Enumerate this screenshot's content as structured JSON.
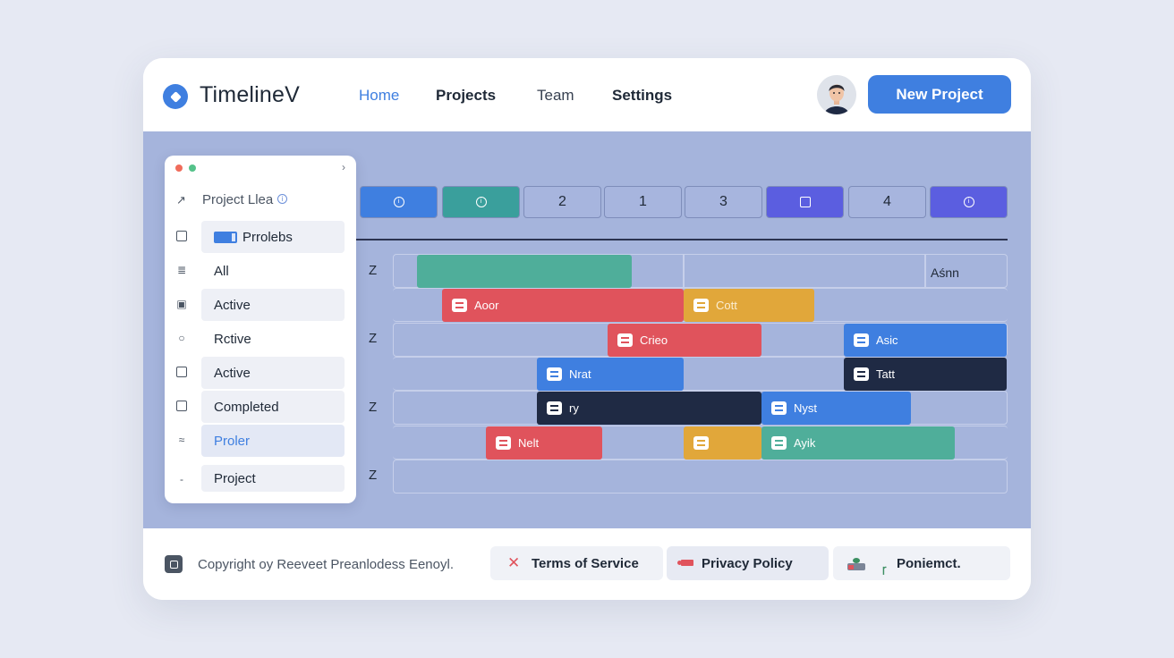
{
  "header": {
    "app_title": "TimelineV",
    "nav": [
      "Home",
      "Projects",
      "Team",
      "Settings"
    ],
    "new_project_label": "New Project"
  },
  "side_panel": {
    "title": "Project Llea",
    "info_glyph": "i",
    "chevron": "›",
    "items": [
      {
        "icon": "square-icon",
        "label": "Prrolebs"
      },
      {
        "icon": "list-icon",
        "label": "All"
      },
      {
        "icon": "play-icon",
        "label": "Active"
      },
      {
        "icon": "chat-icon",
        "label": "Rctive"
      },
      {
        "icon": "square-icon",
        "label": "Active"
      },
      {
        "icon": "square-icon",
        "label": "Completed"
      },
      {
        "icon": "chevrons-icon",
        "label": "Proler"
      },
      {
        "icon": "dash-icon",
        "label": "Project"
      }
    ]
  },
  "timeline": {
    "phases": [
      {
        "type": "icon",
        "color": "#3f7fe0",
        "icon": "circle-icon"
      },
      {
        "type": "icon",
        "color": "#3a9f9c",
        "icon": "circle-icon"
      },
      {
        "type": "text",
        "label": "2"
      },
      {
        "type": "text",
        "label": "1"
      },
      {
        "type": "text",
        "label": "3"
      },
      {
        "type": "icon",
        "color": "#5b5ee0",
        "icon": "square-icon"
      },
      {
        "type": "text",
        "label": "4"
      },
      {
        "type": "icon",
        "color": "#5b5ee0",
        "icon": "circle-icon"
      }
    ],
    "lane_glyph": "Z",
    "assignee_label": "Aśnn",
    "tasks": [
      {
        "label": "Aoor",
        "color": "red"
      },
      {
        "label": "Cott",
        "color": "amber"
      },
      {
        "label": "Crieo",
        "color": "red"
      },
      {
        "label": "Asic",
        "color": "blue"
      },
      {
        "label": "Nrat",
        "color": "blue"
      },
      {
        "label": "Tatt",
        "color": "navy"
      },
      {
        "label": "ry",
        "color": "navy"
      },
      {
        "label": "Nyst",
        "color": "blue"
      },
      {
        "label": "Nelt",
        "color": "red"
      },
      {
        "label": "",
        "color": "amber"
      },
      {
        "label": "Ayik",
        "color": "green"
      }
    ]
  },
  "footer": {
    "copyright": "Copyright oy Reeveet Preanlodess Eenoyl.",
    "terms_label": "Terms of Service",
    "privacy_label": "Privacy Policy",
    "more_label": "Poniemct.",
    "more_prefix": "ꞅ"
  },
  "colors": {
    "accent": "#3f7fe0",
    "main_bg": "#a5b4dc",
    "red": "#e0535c",
    "green": "#4fae9a",
    "amber": "#e1a73a",
    "navy": "#1f2a44",
    "purple": "#5b5ee0"
  }
}
